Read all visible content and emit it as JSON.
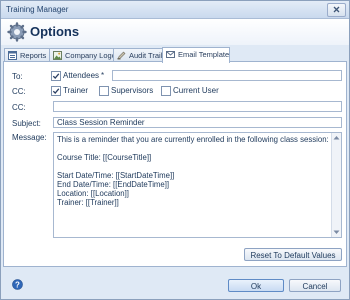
{
  "window": {
    "title": "Training Manager"
  },
  "header": {
    "title": "Options"
  },
  "tabs": [
    {
      "label": "Reports"
    },
    {
      "label": "Company Logo"
    },
    {
      "label": "Audit Trail"
    },
    {
      "label": "Email Template"
    }
  ],
  "form": {
    "to_label": "To:",
    "to_attendees": "Attendees",
    "to_required_mark": "*",
    "to_value": "",
    "cc1_label": "CC:",
    "cc_trainer": "Trainer",
    "cc_supervisors": "Supervisors",
    "cc_current_user": "Current User",
    "cc2_label": "CC:",
    "cc2_value": "",
    "subject_label": "Subject:",
    "subject_value": "Class Session Reminder",
    "message_label": "Message:",
    "message_lines": [
      "This is a reminder that you are currently enrolled in the following class session:",
      "",
      "Course Title: [[CourseTitle]]",
      "",
      "Start Date/Time: [[StartDateTime]]",
      "End Date/Time: [[EndDateTime]]",
      "Location: [[Location]]",
      "Trainer: [[Trainer]]"
    ],
    "checks": {
      "attendees": true,
      "trainer": true,
      "supervisors": false,
      "current_user": false
    }
  },
  "buttons": {
    "reset": "Reset To Default Values",
    "ok": "Ok",
    "cancel": "Cancel"
  }
}
